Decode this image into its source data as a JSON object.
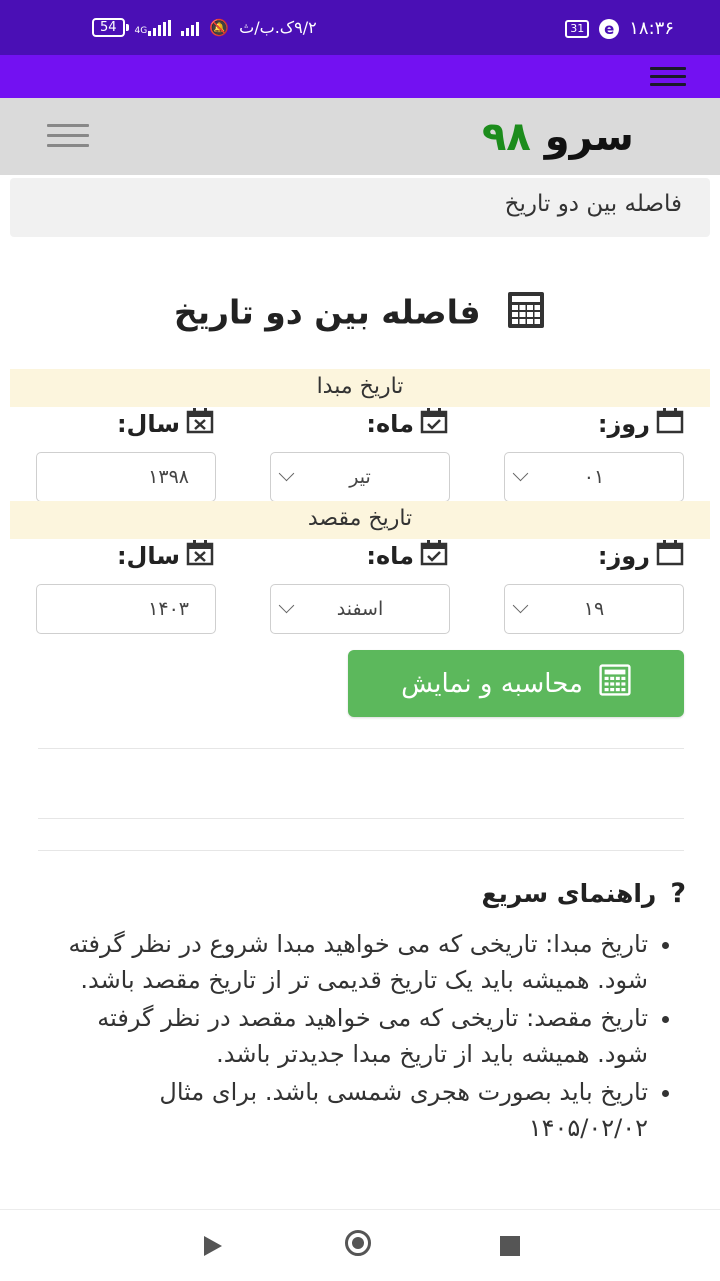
{
  "status_bar": {
    "battery": "54",
    "network": "4G",
    "speed": "۹/۲ک.ب/ث",
    "calendar_day": "31",
    "time": "۱۸:۳۶"
  },
  "site": {
    "logo_text": "سرو",
    "logo_number": "۹۸"
  },
  "breadcrumb": "فاصله بین دو تاریخ",
  "page_title": "فاصله بین دو تاریخ",
  "origin": {
    "heading": "تاریخ مبدا",
    "day_label": "روز:",
    "month_label": "ماه:",
    "year_label": "سال:",
    "day_value": "۰۱",
    "month_value": "تیر",
    "year_value": "۱۳۹۸"
  },
  "destination": {
    "heading": "تاریخ مقصد",
    "day_label": "روز:",
    "month_label": "ماه:",
    "year_label": "سال:",
    "day_value": "۱۹",
    "month_value": "اسفند",
    "year_value": "۱۴۰۳"
  },
  "calculate_button": "محاسبه و نمایش",
  "help": {
    "title": "راهنمای سریع",
    "icon": "?",
    "items": [
      "تاریخ مبدا: تاریخی که می خواهید مبدا شروع در نظر گرفته شود. همیشه باید یک تاریخ قدیمی تر از تاریخ مقصد باشد.",
      "تاریخ مقصد: تاریخی که می خواهید مقصد در نظر گرفته شود. همیشه باید از تاریخ مبدا جدیدتر باشد.",
      "تاریخ باید بصورت هجری شمسی باشد. برای مثال ۱۴۰۵/۰۲/۰۲"
    ]
  },
  "colors": {
    "status_bar": "#4a0fb5",
    "app_bar": "#7311f2",
    "button": "#5cb85c",
    "logo_number": "#1c8c1c",
    "section_bar": "#fcf5dd"
  }
}
